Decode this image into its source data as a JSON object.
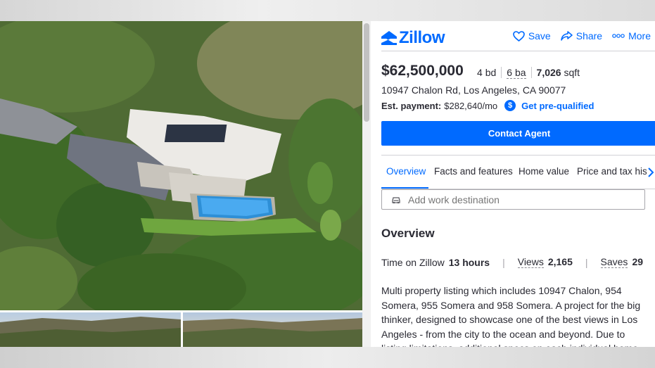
{
  "header": {
    "logo": "Zillow",
    "actions": [
      {
        "label": "Save",
        "icon": "heart-icon"
      },
      {
        "label": "Share",
        "icon": "share-icon"
      },
      {
        "label": "More",
        "icon": "more-dots-icon"
      }
    ]
  },
  "listing": {
    "price": "$62,500,000",
    "beds_value": "4",
    "beds_unit": "bd",
    "baths_value": "6",
    "baths_unit": "ba",
    "sqft_value": "7,026",
    "sqft_unit": "sqft",
    "address": "10947 Chalon Rd, Los Angeles, CA 90077",
    "est_payment_label": "Est. payment:",
    "est_payment_value": "$282,640/mo",
    "dollar_glyph": "$",
    "prequal_label": "Get pre-qualified",
    "contact_label": "Contact Agent"
  },
  "tabs": [
    "Overview",
    "Facts and features",
    "Home value",
    "Price and tax history"
  ],
  "work_destination_placeholder": "Add work destination",
  "overview": {
    "title": "Overview",
    "time_label": "Time on Zillow",
    "time_value": "13 hours",
    "views_label": "Views",
    "views_value": "2,165",
    "saves_label": "Saves",
    "saves_value": "29",
    "description": "Multi property listing which includes 10947 Chalon, 954 Somera, 955 Somera and 958 Somera. A project for the big thinker, designed to showcase one of the best views in Los Angeles - from the city to the ocean and beyond. Due to listing limitations, additional specs on each individual home"
  },
  "colors": {
    "brand": "#006aff",
    "text": "#2a2a33"
  }
}
